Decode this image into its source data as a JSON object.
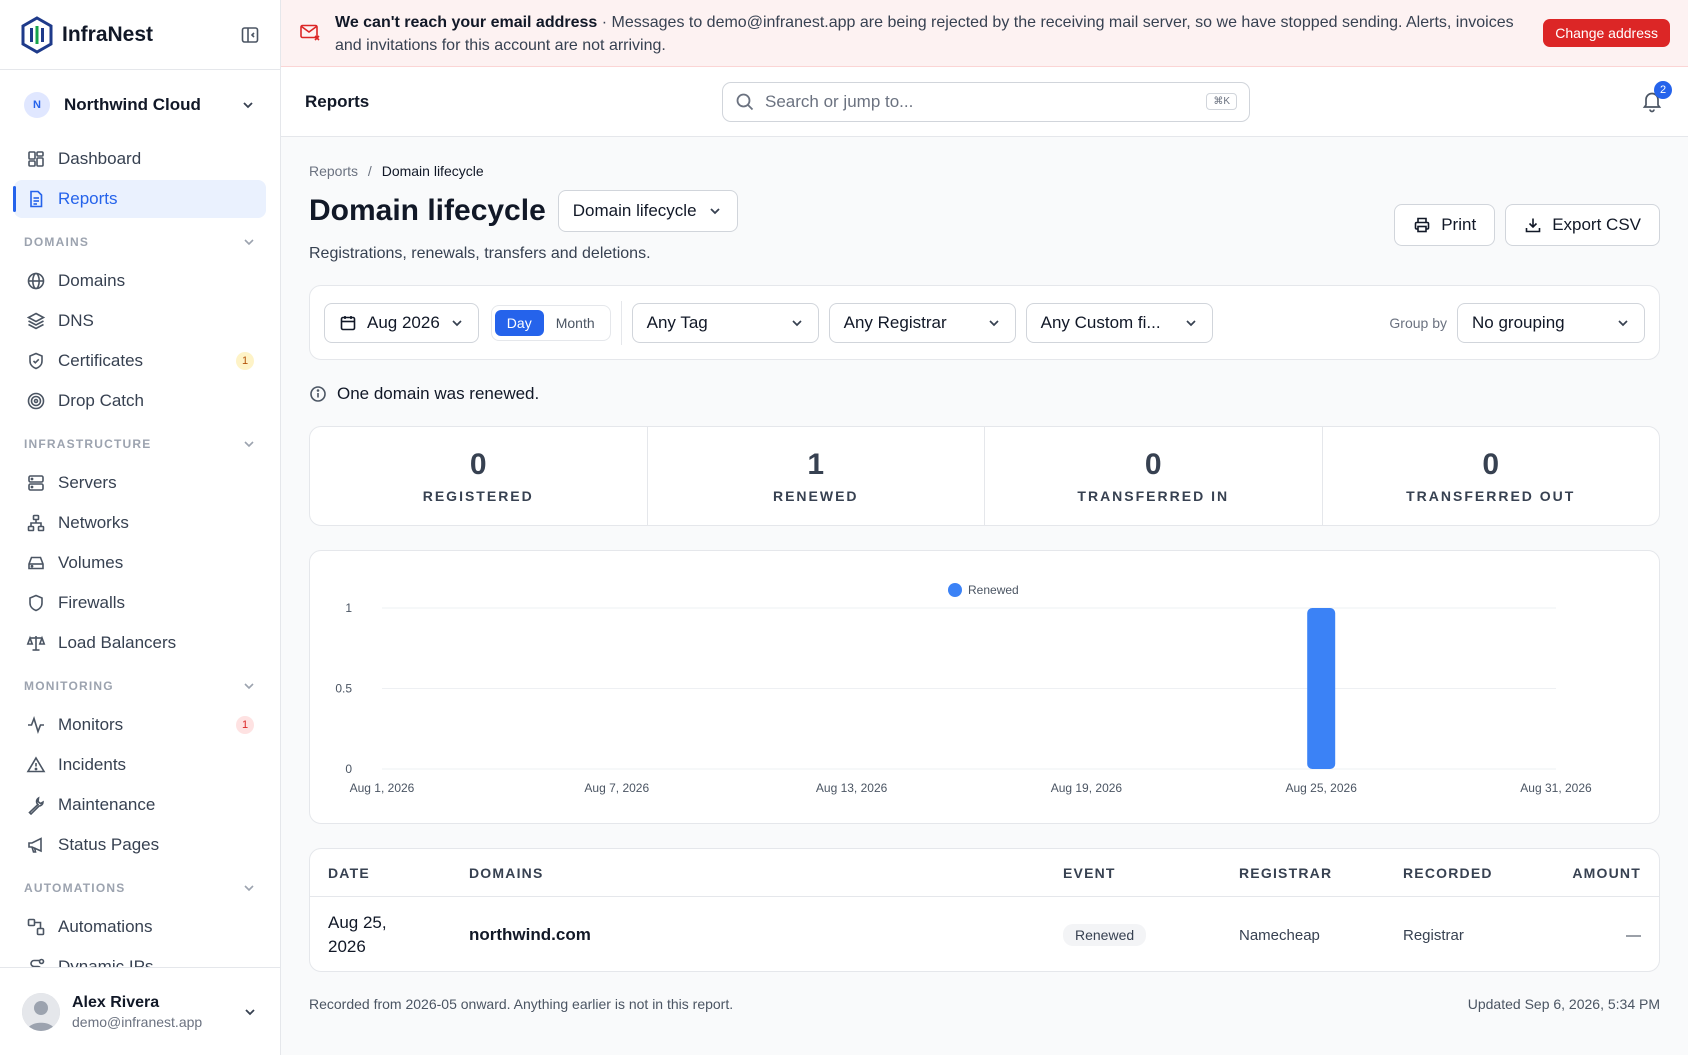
{
  "brand": {
    "name": "InfraNest"
  },
  "org": {
    "initial": "N",
    "name": "Northwind Cloud"
  },
  "nav": {
    "dashboard": "Dashboard",
    "reports": "Reports",
    "sections": {
      "domains": "DOMAINS",
      "infrastructure": "INFRASTRUCTURE",
      "monitoring": "MONITORING",
      "automations": "AUTOMATIONS"
    },
    "domains": "Domains",
    "dns": "DNS",
    "certificates": "Certificates",
    "certificates_badge": "1",
    "drop_catch": "Drop Catch",
    "servers": "Servers",
    "networks": "Networks",
    "volumes": "Volumes",
    "firewalls": "Firewalls",
    "load_balancers": "Load Balancers",
    "monitors": "Monitors",
    "monitors_badge": "1",
    "incidents": "Incidents",
    "maintenance": "Maintenance",
    "status_pages": "Status Pages",
    "automations": "Automations",
    "dynamic_ips": "Dynamic IPs"
  },
  "user": {
    "name": "Alex Rivera",
    "email": "demo@infranest.app"
  },
  "banner": {
    "title": "We can't reach your email address",
    "message": " · Messages to demo@infranest.app are being rejected by the receiving mail server, so we have stopped sending. Alerts, invoices and invitations for this account are not arriving.",
    "button": "Change address"
  },
  "topbar": {
    "title": "Reports",
    "search_placeholder": "Search or jump to...",
    "shortcut": "⌘K",
    "notifications": "2"
  },
  "page": {
    "crumb_root": "Reports",
    "crumb_sep": "/",
    "crumb_current": "Domain lifecycle",
    "title": "Domain lifecycle",
    "report_select": "Domain lifecycle",
    "print": "Print",
    "export": "Export CSV",
    "subtitle": "Registrations, renewals, transfers and deletions."
  },
  "filters": {
    "period": "Aug 2026",
    "day": "Day",
    "month": "Month",
    "tag": "Any Tag",
    "registrar": "Any Registrar",
    "custom": "Any Custom fi...",
    "group_label": "Group by",
    "group_value": "No grouping"
  },
  "note": "One domain was renewed.",
  "stats": [
    {
      "value": "0",
      "label": "REGISTERED"
    },
    {
      "value": "1",
      "label": "RENEWED"
    },
    {
      "value": "0",
      "label": "TRANSFERRED IN"
    },
    {
      "value": "0",
      "label": "TRANSFERRED OUT"
    }
  ],
  "chart_data": {
    "type": "bar",
    "series": [
      {
        "name": "Renewed",
        "color": "#3b82f6",
        "x": [
          "Aug 25, 2026"
        ],
        "values": [
          1
        ]
      }
    ],
    "x_range": [
      "Aug 1, 2026",
      "Aug 31, 2026"
    ],
    "x_ticks": [
      "Aug 1, 2026",
      "Aug 7, 2026",
      "Aug 13, 2026",
      "Aug 19, 2026",
      "Aug 25, 2026",
      "Aug 31, 2026"
    ],
    "y_ticks": [
      "1",
      "0.5",
      "0"
    ],
    "ylim": [
      0,
      1
    ],
    "grid": true,
    "legend": "top-center"
  },
  "table": {
    "headers": [
      "DATE",
      "DOMAINS",
      "EVENT",
      "REGISTRAR",
      "RECORDED",
      "AMOUNT"
    ],
    "rows": [
      {
        "date_line1": "Aug 25,",
        "date_line2": "2026",
        "domain": "northwind.com",
        "event": "Renewed",
        "registrar": "Namecheap",
        "recorded": "Registrar",
        "amount": "—"
      }
    ]
  },
  "footer": {
    "left": "Recorded from 2026-05 onward. Anything earlier is not in this report.",
    "right": "Updated Sep 6, 2026, 5:34 PM"
  }
}
